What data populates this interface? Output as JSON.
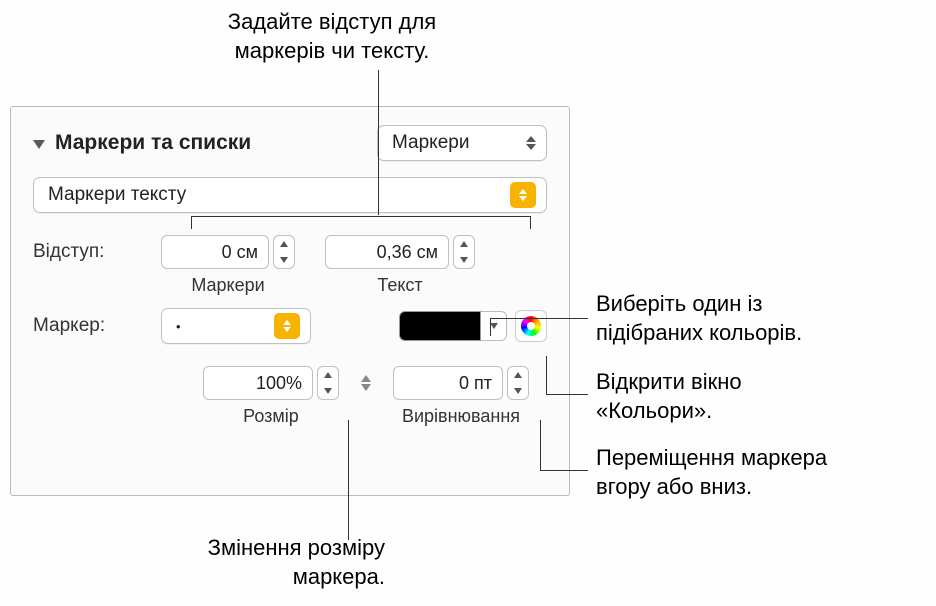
{
  "callouts": {
    "top": "Задайте відступ для\nмаркерів чи тексту.",
    "color_swatch": "Виберіть один із\nпідібраних кольорів.",
    "color_wheel": "Відкрити вікно\n«Кольори».",
    "alignment": "Переміщення маркера\nвгору або вниз.",
    "size": "Змінення розміру\nмаркера."
  },
  "panel": {
    "section_title": "Маркери та списки",
    "preset_select": "Маркери",
    "bullet_type_select": "Маркери тексту",
    "indent_label": "Відступ:",
    "indent_marker_value": "0 см",
    "indent_marker_caption": "Маркери",
    "indent_text_value": "0,36 см",
    "indent_text_caption": "Текст",
    "marker_label": "Маркер:",
    "marker_glyph": "•",
    "size_value": "100%",
    "size_caption": "Розмір",
    "align_value": "0 пт",
    "align_caption": "Вирівнювання",
    "color_hex": "#000000"
  }
}
